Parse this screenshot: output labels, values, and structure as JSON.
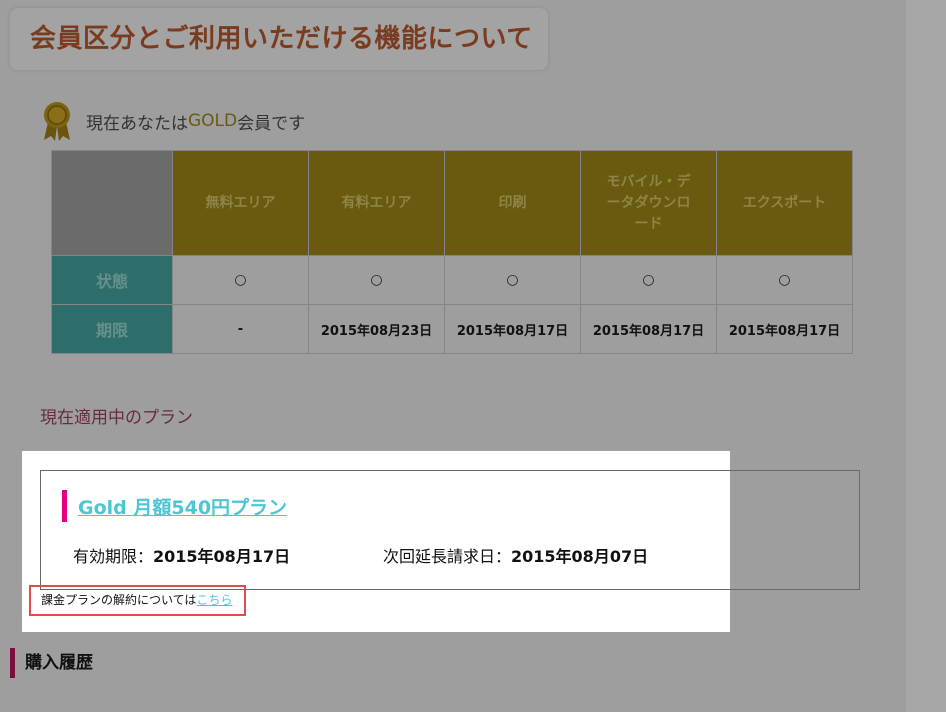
{
  "page": {
    "title": "会員区分とご利用いただける機能について"
  },
  "membership": {
    "prefix": "現在あなたは",
    "level": "GOLD",
    "suffix": "会員です",
    "medal_icon": "gold-medal-icon"
  },
  "feature_table": {
    "columns": [
      "無料エリア",
      "有料エリア",
      "印刷",
      "モバイル・データダウンロード",
      "エクスポート"
    ],
    "column_lines": [
      [
        "無料エリア"
      ],
      [
        "有料エリア"
      ],
      [
        "印刷"
      ],
      [
        "モバイル・デ",
        "ータダウンロ",
        "ード"
      ],
      [
        "エクスポート"
      ]
    ],
    "rows": [
      {
        "label": "状態",
        "values": [
          "○",
          "○",
          "○",
          "○",
          "○"
        ]
      },
      {
        "label": "期限",
        "values": [
          "-",
          "2015年08月23日",
          "2015年08月17日",
          "2015年08月17日",
          "2015年08月17日"
        ]
      }
    ]
  },
  "current_plan": {
    "heading": "現在適用中のプラン",
    "name": "Gold 月額540円プラン",
    "period_label": "有効期限：",
    "period_value": "2015年08月17日",
    "renewal_label": "次回延長請求日：",
    "renewal_value": "2015年08月07日",
    "cancel_text": "課金プランの解約については",
    "cancel_link": "こちら"
  },
  "purchase_history": {
    "heading": "購入履歴"
  },
  "colors": {
    "plan_link": "#4bc6d2",
    "plan_accent": "#e4007f",
    "highlight_border": "#e34b4b",
    "gold_header": "#6a5a0f",
    "teal_row": "#2e6d6a"
  }
}
